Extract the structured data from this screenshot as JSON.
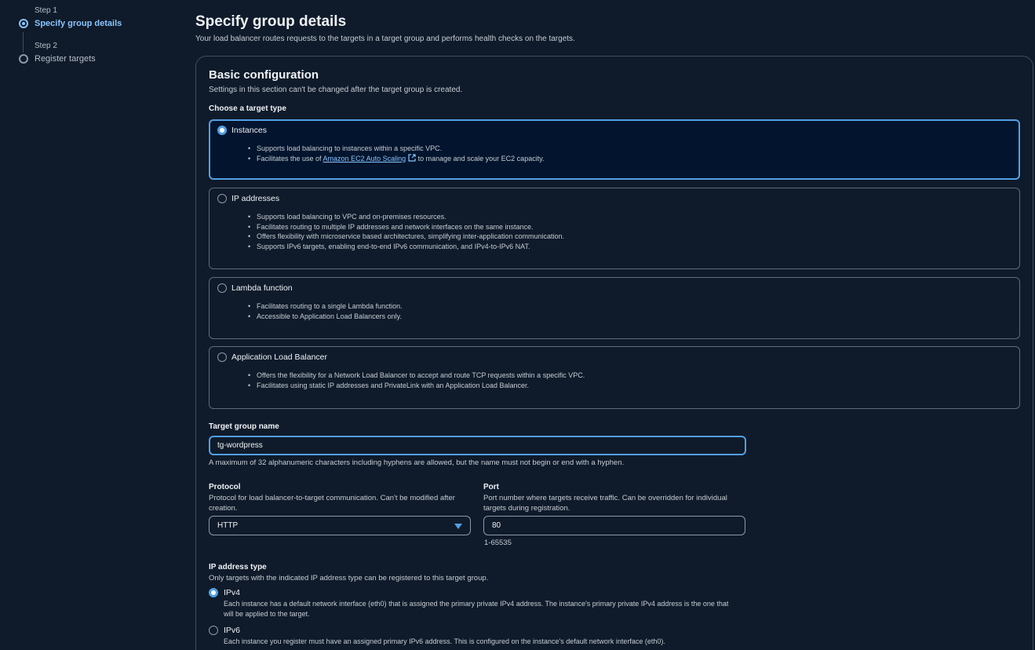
{
  "wizard": {
    "steps": [
      {
        "label": "Step 1",
        "title": "Specify group details"
      },
      {
        "label": "Step 2",
        "title": "Register targets"
      }
    ]
  },
  "page": {
    "title": "Specify group details",
    "description": "Your load balancer routes requests to the targets in a target group and performs health checks on the targets."
  },
  "basic_config": {
    "title": "Basic configuration",
    "description": "Settings in this section can't be changed after the target group is created.",
    "target_type_label": "Choose a target type",
    "target_types": [
      {
        "title": "Instances",
        "selected": true,
        "bullets": [
          "Supports load balancing to instances within a specific VPC."
        ],
        "bullet2_prefix": "Facilitates the use of ",
        "bullet2_link": "Amazon EC2 Auto Scaling",
        "bullet2_suffix": " to manage and scale your EC2 capacity."
      },
      {
        "title": "IP addresses",
        "selected": false,
        "bullets": [
          "Supports load balancing to VPC and on-premises resources.",
          "Facilitates routing to multiple IP addresses and network interfaces on the same instance.",
          "Offers flexibility with microservice based architectures, simplifying inter-application communication.",
          "Supports IPv6 targets, enabling end-to-end IPv6 communication, and IPv4-to-IPv6 NAT."
        ]
      },
      {
        "title": "Lambda function",
        "selected": false,
        "bullets": [
          "Facilitates routing to a single Lambda function.",
          "Accessible to Application Load Balancers only."
        ]
      },
      {
        "title": "Application Load Balancer",
        "selected": false,
        "bullets": [
          "Offers the flexibility for a Network Load Balancer to accept and route TCP requests within a specific VPC.",
          "Facilitates using static IP addresses and PrivateLink with an Application Load Balancer."
        ]
      }
    ],
    "name_label": "Target group name",
    "name_value": "tg-wordpress",
    "name_hint": "A maximum of 32 alphanumeric characters including hyphens are allowed, but the name must not begin or end with a hyphen.",
    "protocol_label": "Protocol",
    "protocol_desc": "Protocol for load balancer-to-target communication. Can't be modified after creation.",
    "protocol_value": "HTTP",
    "port_label": "Port",
    "port_desc": "Port number where targets receive traffic. Can be overridden for individual targets during registration.",
    "port_value": "80",
    "port_hint": "1-65535",
    "ip_type_label": "IP address type",
    "ip_type_desc": "Only targets with the indicated IP address type can be registered to this target group.",
    "ip_types": [
      {
        "title": "IPv4",
        "selected": true,
        "desc": "Each instance has a default network interface (eth0) that is assigned the primary private IPv4 address. The instance's primary private IPv4 address is the one that will be applied to the target."
      },
      {
        "title": "IPv6",
        "selected": false,
        "desc": "Each instance you register must have an assigned primary IPv6 address. This is configured on the instance's default network interface (eth0)."
      }
    ]
  },
  "colors": {
    "accent": "#539fe5",
    "background": "#0f1b2a",
    "border": "#414d5c"
  },
  "icons": {
    "external_link": "external-link-icon",
    "dropdown": "caret-down-icon"
  }
}
